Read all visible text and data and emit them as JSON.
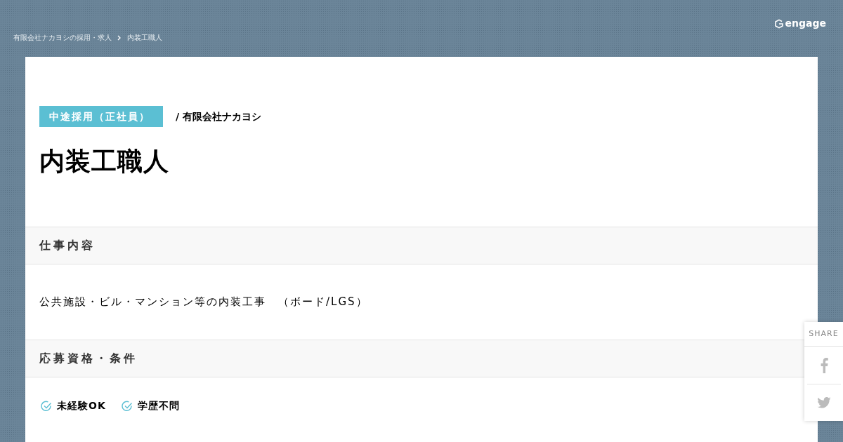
{
  "breadcrumb": [
    {
      "label": "有限会社ナカヨシの採用・求人"
    },
    {
      "label": "内装工職人"
    }
  ],
  "logo": "engage",
  "job": {
    "badge": "中途採用（正社員）",
    "company": "/ 有限会社ナカヨシ",
    "title": "内装工職人"
  },
  "sections": [
    {
      "heading": "仕事内容",
      "kind": "text",
      "text": "公共施設・ビル・マンション等の内装工事　（ボード/LGS）"
    },
    {
      "heading": "応募資格・条件",
      "kind": "tags",
      "tags": [
        "未経験OK",
        "学歴不問"
      ]
    }
  ],
  "share": {
    "label": "SHARE"
  }
}
